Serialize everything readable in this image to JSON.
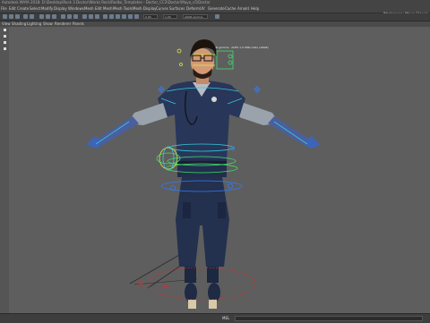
{
  "window": {
    "title": "Autodesk MAYA 2018: D:\\Desktop\\Rock 3 Doctor\\Works Rock\\Rodko_Templates - Doctor_CC3\\Doctor\\Maya_v5\\Doctor"
  },
  "menubar": {
    "items": [
      "File",
      "Edit",
      "Create",
      "Select",
      "Modify",
      "Display",
      "Windows",
      "Mesh",
      "Edit Mesh",
      "Mesh Tools",
      "Mesh Display",
      "Curves",
      "Surfaces",
      "Deform",
      "UV",
      "Generate",
      "Cache",
      "Arnold",
      "Help"
    ],
    "workspace": "Workspace: Maya Classic"
  },
  "toolbar": {
    "field_1": "0.00",
    "field_2": "1.00",
    "field_3": "sRGB gamma",
    "field_4": "ACES 1.0 SDR-video (sRGB)"
  },
  "panel_menu": [
    "View",
    "Shading",
    "Lighting",
    "Show",
    "Renderer",
    "Panels"
  ],
  "viewport": {
    "camera_label": "sRGB gamma · ACES 1.0 SDR-video (sRGB)",
    "background": "#5e5e5e"
  },
  "statusbar": {
    "language": "MEL"
  },
  "colors": {
    "rig_control": "#2e7bff",
    "rig_green": "#3ee06b",
    "rig_yellow": "#e6e64a",
    "rig_red": "#e22a2a",
    "rig_cyan": "#38c8d8"
  }
}
